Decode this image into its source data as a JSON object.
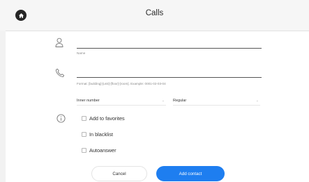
{
  "header": {
    "title": "Calls",
    "home_icon": "home-icon"
  },
  "form": {
    "name": {
      "icon": "person-icon",
      "value": "",
      "hint": "Name"
    },
    "number": {
      "icon": "phone-icon",
      "value": "",
      "hint": "Format: [building]-[unit]-[floor]-[room]. Example: 0001-02-03-04"
    },
    "number_type": {
      "selected": "Inner number"
    },
    "call_mode": {
      "selected": "Regular"
    },
    "info_icon": "info-icon",
    "options": [
      {
        "label": "Add to favorites",
        "checked": false
      },
      {
        "label": "In blacklist",
        "checked": false
      },
      {
        "label": "Autoanswer",
        "checked": false
      }
    ]
  },
  "actions": {
    "cancel_label": "Cancel",
    "add_label": "Add contact"
  },
  "colors": {
    "accent": "#1e7ef0",
    "header_bg": "#f6f6f6"
  }
}
